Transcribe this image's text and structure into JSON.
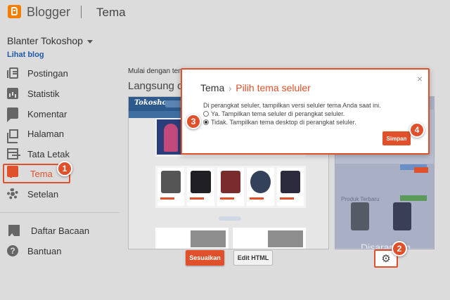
{
  "header": {
    "app_name": "Blogger",
    "section_title": "Tema"
  },
  "sidebar": {
    "blog_name": "Blanter Tokoshop",
    "view_blog": "Lihat blog",
    "items": [
      {
        "label": "Postingan",
        "icon": "posts-icon"
      },
      {
        "label": "Statistik",
        "icon": "stats-icon"
      },
      {
        "label": "Komentar",
        "icon": "comment-icon"
      },
      {
        "label": "Halaman",
        "icon": "pages-icon"
      },
      {
        "label": "Tata Letak",
        "icon": "layout-icon"
      },
      {
        "label": "Tema",
        "icon": "theme-icon",
        "active": true
      },
      {
        "label": "Setelan",
        "icon": "gear-icon"
      }
    ],
    "secondary": [
      {
        "label": "Daftar Bacaan",
        "icon": "bookmark-icon"
      },
      {
        "label": "Bantuan",
        "icon": "help-icon"
      }
    ]
  },
  "main": {
    "intro": "Mulai dengan tema",
    "live_heading": "Langsung di Blog",
    "preview_logo": "Tokoshop",
    "mobile_section_heading": "Produk Terbaru",
    "mobile_caption": "Disarankan",
    "customize_label": "Sesuaikan",
    "edit_html_label": "Edit HTML",
    "settings_icon": "gear-icon"
  },
  "dialog": {
    "breadcrumb_root": "Tema",
    "breadcrumb_separator": "›",
    "breadcrumb_current": "Pilih tema seluler",
    "close_symbol": "×",
    "description": "Di perangkat seluler, tampilkan versi seluler tema Anda saat ini.",
    "options": [
      {
        "label": "Ya. Tampilkan tema seluler di perangkat seluler.",
        "selected": false
      },
      {
        "label": "Tidak. Tampilkan tema desktop di perangkat seluler.",
        "selected": true
      }
    ],
    "save_label": "Simpan"
  },
  "steps": [
    "1",
    "2",
    "3",
    "4"
  ],
  "colors": {
    "accent": "#e0512b",
    "link": "#1e5aa8",
    "background": "#dcdcdc",
    "preview_header": "#2c5a8c"
  }
}
